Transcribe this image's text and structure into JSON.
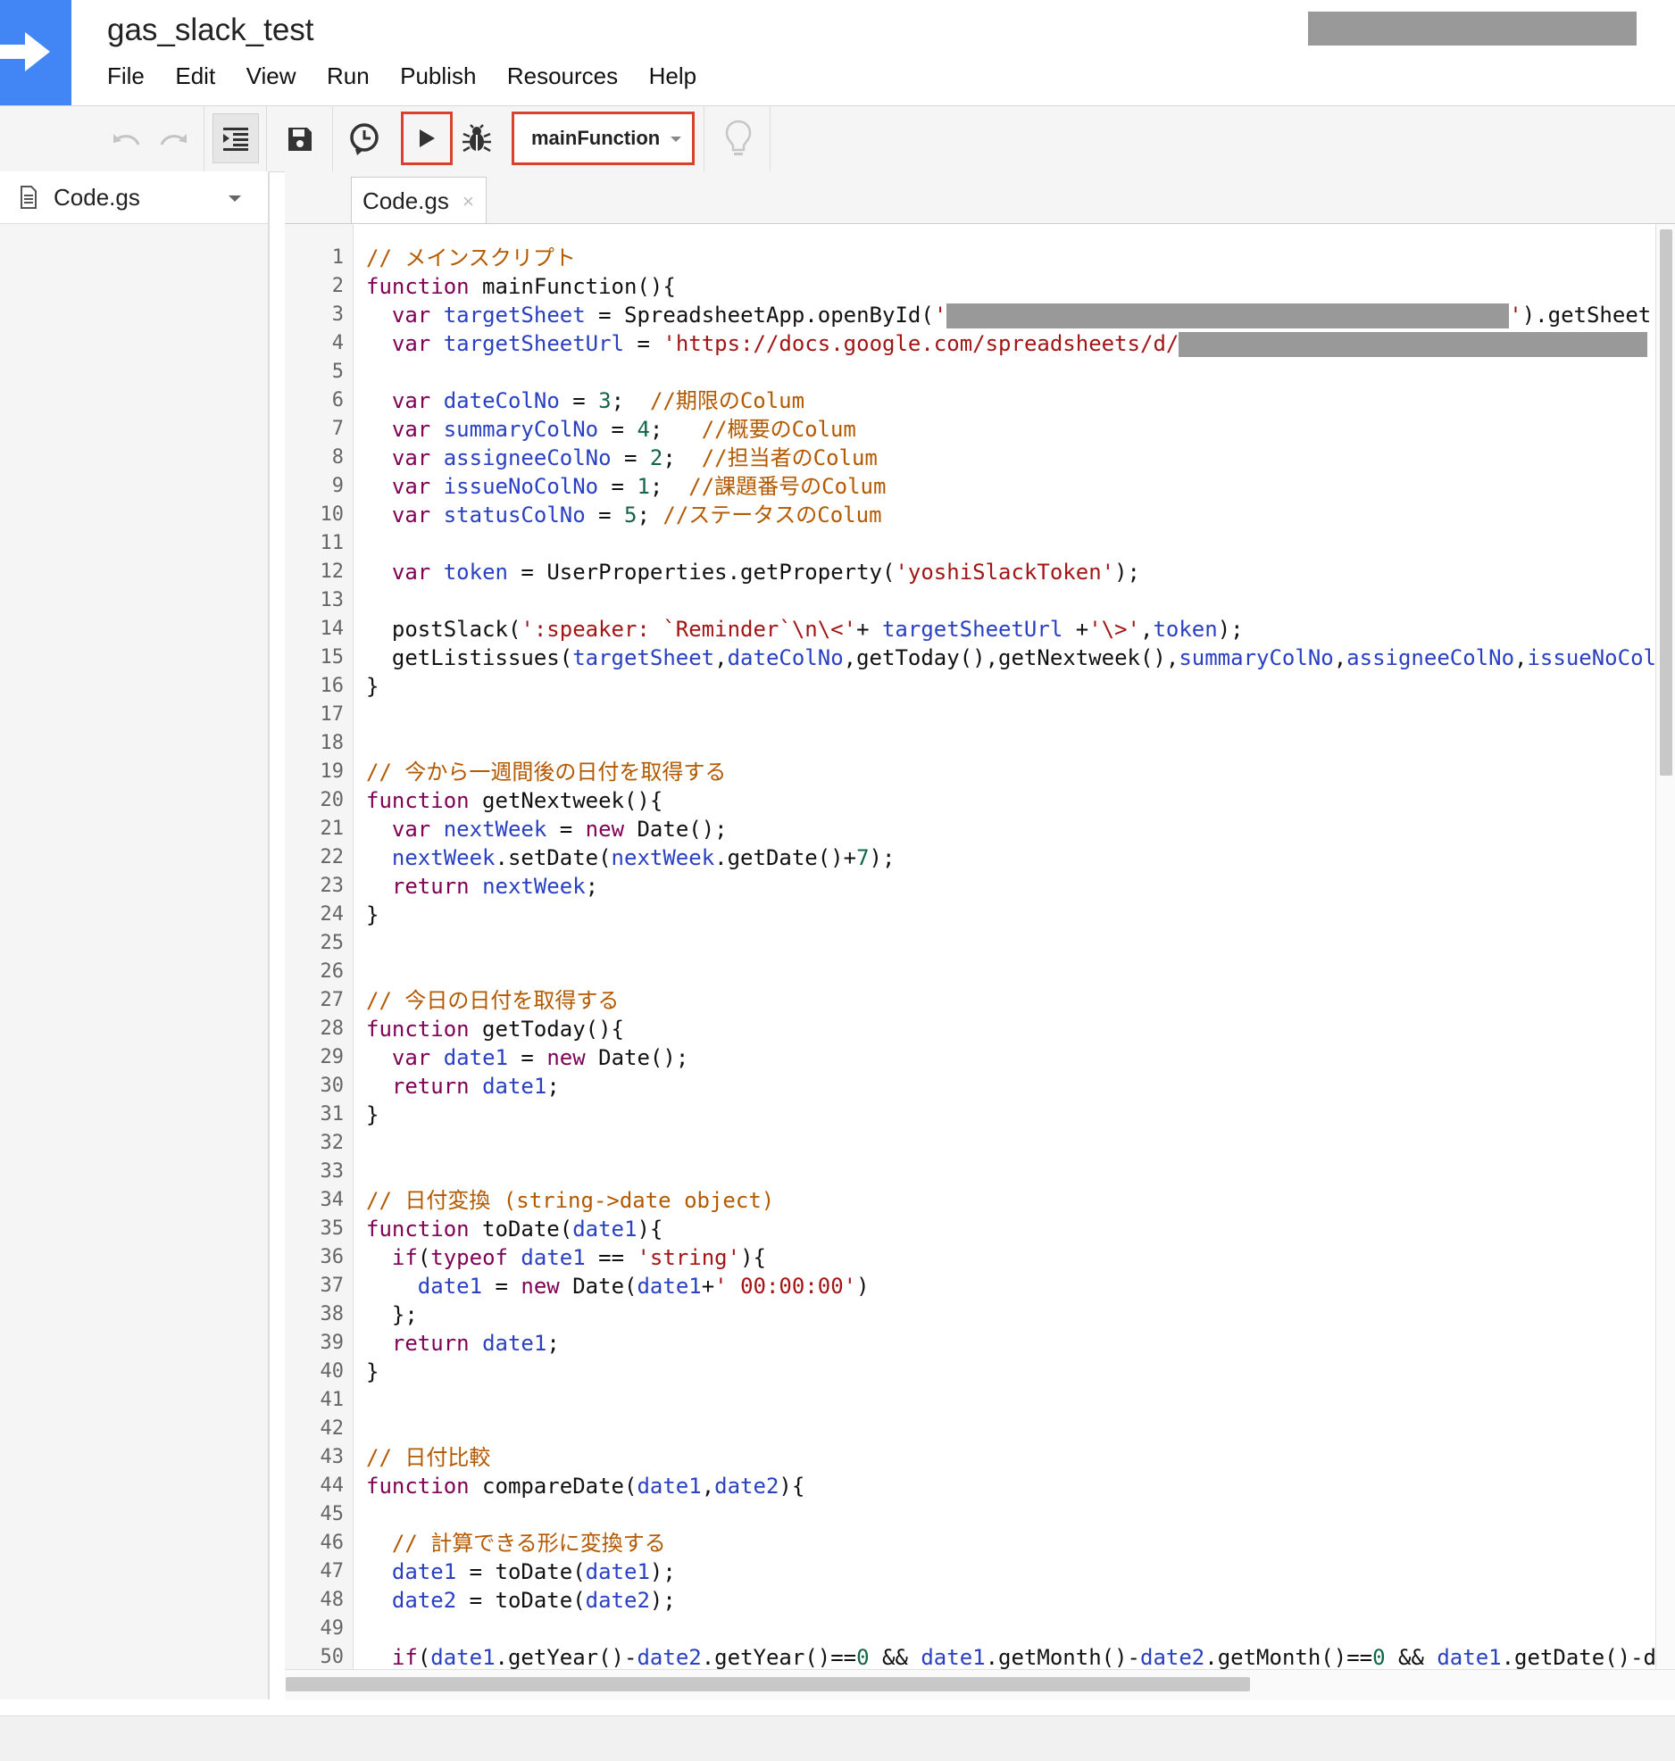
{
  "header": {
    "project_title": "gas_slack_test",
    "menu": [
      "File",
      "Edit",
      "View",
      "Run",
      "Publish",
      "Resources",
      "Help"
    ]
  },
  "toolbar": {
    "function_select": "mainFunction"
  },
  "sidebar": {
    "file_name": "Code.gs"
  },
  "editor": {
    "tab_label": "Code.gs",
    "tab_close": "×"
  },
  "colors": {
    "logo_bg": "#4285f4",
    "highlight_border": "#d9412f",
    "keyword": "#7f0055",
    "variable": "#2940c2",
    "comment": "#b35900",
    "string": "#a31515",
    "number": "#116644"
  },
  "code_lines": [
    [
      [
        "cm",
        "// メインスクリプト"
      ]
    ],
    [
      [
        "kw",
        "function"
      ],
      [
        "tx",
        " mainFunction(){"
      ]
    ],
    [
      [
        "tx",
        "  "
      ],
      [
        "kw",
        "var"
      ],
      [
        "tx",
        " "
      ],
      [
        "vr",
        "targetSheet"
      ],
      [
        "tx",
        " = SpreadsheetApp.openById("
      ],
      [
        "st",
        "'"
      ],
      [
        "rd",
        ""
      ],
      [
        "st",
        "'"
      ],
      [
        "tx",
        ").getSheet"
      ]
    ],
    [
      [
        "tx",
        "  "
      ],
      [
        "kw",
        "var"
      ],
      [
        "tx",
        " "
      ],
      [
        "vr",
        "targetSheetUrl"
      ],
      [
        "tx",
        " = "
      ],
      [
        "st",
        "'https://docs.google.com/spreadsheets/d/"
      ],
      [
        "rd2",
        ""
      ]
    ],
    [],
    [
      [
        "tx",
        "  "
      ],
      [
        "kw",
        "var"
      ],
      [
        "tx",
        " "
      ],
      [
        "vr",
        "dateColNo"
      ],
      [
        "tx",
        " = "
      ],
      [
        "nm",
        "3"
      ],
      [
        "tx",
        ";  "
      ],
      [
        "cm",
        "//期限のColum"
      ]
    ],
    [
      [
        "tx",
        "  "
      ],
      [
        "kw",
        "var"
      ],
      [
        "tx",
        " "
      ],
      [
        "vr",
        "summaryColNo"
      ],
      [
        "tx",
        " = "
      ],
      [
        "nm",
        "4"
      ],
      [
        "tx",
        ";   "
      ],
      [
        "cm",
        "//概要のColum"
      ]
    ],
    [
      [
        "tx",
        "  "
      ],
      [
        "kw",
        "var"
      ],
      [
        "tx",
        " "
      ],
      [
        "vr",
        "assigneeColNo"
      ],
      [
        "tx",
        " = "
      ],
      [
        "nm",
        "2"
      ],
      [
        "tx",
        ";  "
      ],
      [
        "cm",
        "//担当者のColum"
      ]
    ],
    [
      [
        "tx",
        "  "
      ],
      [
        "kw",
        "var"
      ],
      [
        "tx",
        " "
      ],
      [
        "vr",
        "issueNoColNo"
      ],
      [
        "tx",
        " = "
      ],
      [
        "nm",
        "1"
      ],
      [
        "tx",
        ";  "
      ],
      [
        "cm",
        "//課題番号のColum"
      ]
    ],
    [
      [
        "tx",
        "  "
      ],
      [
        "kw",
        "var"
      ],
      [
        "tx",
        " "
      ],
      [
        "vr",
        "statusColNo"
      ],
      [
        "tx",
        " = "
      ],
      [
        "nm",
        "5"
      ],
      [
        "tx",
        "; "
      ],
      [
        "cm",
        "//ステータスのColum"
      ]
    ],
    [],
    [
      [
        "tx",
        "  "
      ],
      [
        "kw",
        "var"
      ],
      [
        "tx",
        " "
      ],
      [
        "vr",
        "token"
      ],
      [
        "tx",
        " = UserProperties.getProperty("
      ],
      [
        "st",
        "'yoshiSlackToken'"
      ],
      [
        "tx",
        ");"
      ]
    ],
    [],
    [
      [
        "tx",
        "  postSlack("
      ],
      [
        "st",
        "':speaker: `Reminder`\\n\\<'"
      ],
      [
        "tx",
        "+ "
      ],
      [
        "vr",
        "targetSheetUrl"
      ],
      [
        "tx",
        " +"
      ],
      [
        "st",
        "'\\>'"
      ],
      [
        "tx",
        ","
      ],
      [
        "vr",
        "token"
      ],
      [
        "tx",
        ");"
      ]
    ],
    [
      [
        "tx",
        "  getListissues("
      ],
      [
        "vr",
        "targetSheet"
      ],
      [
        "tx",
        ","
      ],
      [
        "vr",
        "dateColNo"
      ],
      [
        "tx",
        ",getToday(),getNextweek(),"
      ],
      [
        "vr",
        "summaryColNo"
      ],
      [
        "tx",
        ","
      ],
      [
        "vr",
        "assigneeColNo"
      ],
      [
        "tx",
        ","
      ],
      [
        "vr",
        "issueNoCol"
      ]
    ],
    [
      [
        "tx",
        "}"
      ]
    ],
    [],
    [],
    [
      [
        "cm",
        "// 今から一週間後の日付を取得する"
      ]
    ],
    [
      [
        "kw",
        "function"
      ],
      [
        "tx",
        " getNextweek(){"
      ]
    ],
    [
      [
        "tx",
        "  "
      ],
      [
        "kw",
        "var"
      ],
      [
        "tx",
        " "
      ],
      [
        "vr",
        "nextWeek"
      ],
      [
        "tx",
        " = "
      ],
      [
        "kw",
        "new"
      ],
      [
        "tx",
        " Date();"
      ]
    ],
    [
      [
        "tx",
        "  "
      ],
      [
        "vr",
        "nextWeek"
      ],
      [
        "tx",
        ".setDate("
      ],
      [
        "vr",
        "nextWeek"
      ],
      [
        "tx",
        ".getDate()+"
      ],
      [
        "nm",
        "7"
      ],
      [
        "tx",
        ");"
      ]
    ],
    [
      [
        "tx",
        "  "
      ],
      [
        "kw",
        "return"
      ],
      [
        "tx",
        " "
      ],
      [
        "vr",
        "nextWeek"
      ],
      [
        "tx",
        ";"
      ]
    ],
    [
      [
        "tx",
        "}"
      ]
    ],
    [],
    [],
    [
      [
        "cm",
        "// 今日の日付を取得する"
      ]
    ],
    [
      [
        "kw",
        "function"
      ],
      [
        "tx",
        " getToday(){"
      ]
    ],
    [
      [
        "tx",
        "  "
      ],
      [
        "kw",
        "var"
      ],
      [
        "tx",
        " "
      ],
      [
        "vr",
        "date1"
      ],
      [
        "tx",
        " = "
      ],
      [
        "kw",
        "new"
      ],
      [
        "tx",
        " Date();"
      ]
    ],
    [
      [
        "tx",
        "  "
      ],
      [
        "kw",
        "return"
      ],
      [
        "tx",
        " "
      ],
      [
        "vr",
        "date1"
      ],
      [
        "tx",
        ";"
      ]
    ],
    [
      [
        "tx",
        "}"
      ]
    ],
    [],
    [],
    [
      [
        "cm",
        "// 日付変換 (string->date object)"
      ]
    ],
    [
      [
        "kw",
        "function"
      ],
      [
        "tx",
        " toDate("
      ],
      [
        "vr",
        "date1"
      ],
      [
        "tx",
        "){"
      ]
    ],
    [
      [
        "tx",
        "  "
      ],
      [
        "kw",
        "if"
      ],
      [
        "tx",
        "("
      ],
      [
        "kw",
        "typeof"
      ],
      [
        "tx",
        " "
      ],
      [
        "vr",
        "date1"
      ],
      [
        "tx",
        " == "
      ],
      [
        "st",
        "'string'"
      ],
      [
        "tx",
        "){"
      ]
    ],
    [
      [
        "tx",
        "    "
      ],
      [
        "vr",
        "date1"
      ],
      [
        "tx",
        " = "
      ],
      [
        "kw",
        "new"
      ],
      [
        "tx",
        " Date("
      ],
      [
        "vr",
        "date1"
      ],
      [
        "tx",
        "+"
      ],
      [
        "st",
        "' 00:00:00'"
      ],
      [
        "tx",
        ")"
      ]
    ],
    [
      [
        "tx",
        "  };"
      ]
    ],
    [
      [
        "tx",
        "  "
      ],
      [
        "kw",
        "return"
      ],
      [
        "tx",
        " "
      ],
      [
        "vr",
        "date1"
      ],
      [
        "tx",
        ";"
      ]
    ],
    [
      [
        "tx",
        "}"
      ]
    ],
    [],
    [],
    [
      [
        "cm",
        "// 日付比較"
      ]
    ],
    [
      [
        "kw",
        "function"
      ],
      [
        "tx",
        " compareDate("
      ],
      [
        "vr",
        "date1"
      ],
      [
        "tx",
        ","
      ],
      [
        "vr",
        "date2"
      ],
      [
        "tx",
        "){"
      ]
    ],
    [],
    [
      [
        "tx",
        "  "
      ],
      [
        "cm",
        "// 計算できる形に変換する"
      ]
    ],
    [
      [
        "tx",
        "  "
      ],
      [
        "vr",
        "date1"
      ],
      [
        "tx",
        " = toDate("
      ],
      [
        "vr",
        "date1"
      ],
      [
        "tx",
        ");"
      ]
    ],
    [
      [
        "tx",
        "  "
      ],
      [
        "vr",
        "date2"
      ],
      [
        "tx",
        " = toDate("
      ],
      [
        "vr",
        "date2"
      ],
      [
        "tx",
        ");"
      ]
    ],
    [],
    [
      [
        "tx",
        "  "
      ],
      [
        "kw",
        "if"
      ],
      [
        "tx",
        "("
      ],
      [
        "vr",
        "date1"
      ],
      [
        "tx",
        ".getYear()-"
      ],
      [
        "vr",
        "date2"
      ],
      [
        "tx",
        ".getYear()=="
      ],
      [
        "nm",
        "0"
      ],
      [
        "tx",
        " && "
      ],
      [
        "vr",
        "date1"
      ],
      [
        "tx",
        ".getMonth()-"
      ],
      [
        "vr",
        "date2"
      ],
      [
        "tx",
        ".getMonth()=="
      ],
      [
        "nm",
        "0"
      ],
      [
        "tx",
        " && "
      ],
      [
        "vr",
        "date1"
      ],
      [
        "tx",
        ".getDate()-d"
      ]
    ]
  ]
}
